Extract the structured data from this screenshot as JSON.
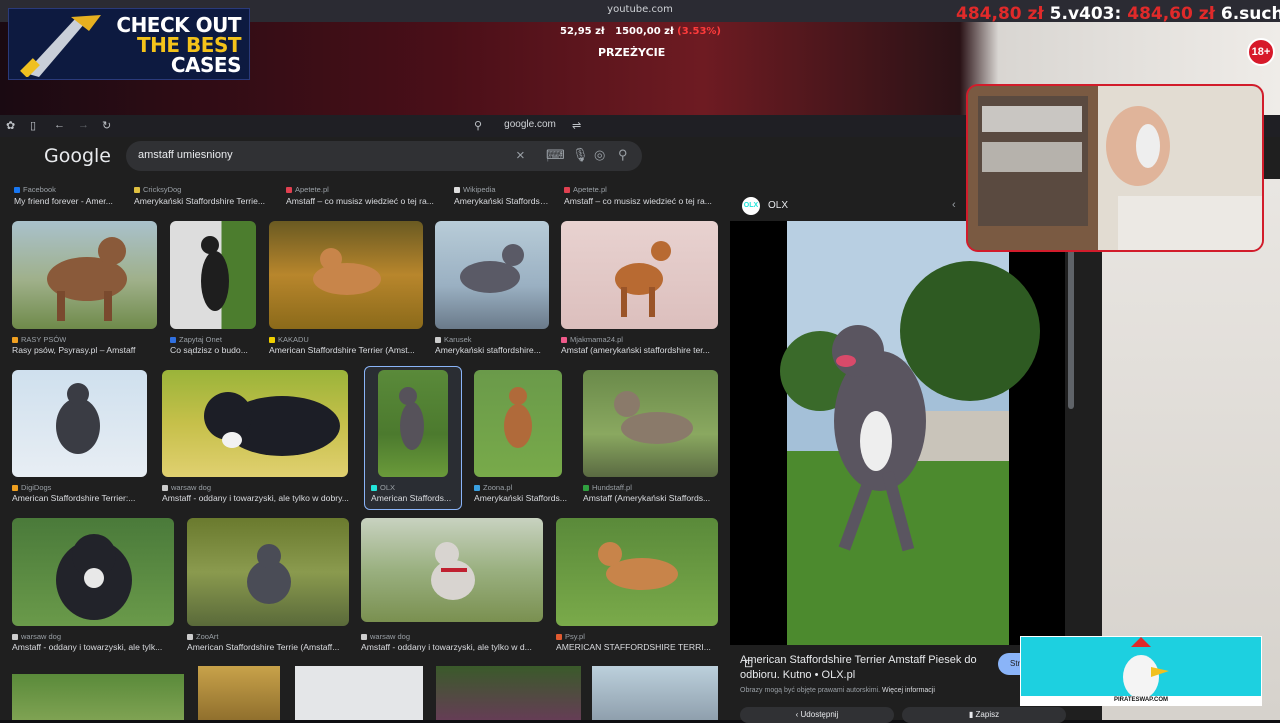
{
  "stream": {
    "top_url": "youtube.com",
    "promo": {
      "line1": "CHECK OUT",
      "line2": "THE BEST",
      "line3": "CASES"
    },
    "price_a": "52,95 zł",
    "price_b": "1500,00 zł",
    "price_pct": "(3.53%)",
    "label": "PRZEŻYCIE",
    "ticker_price1": "484,80 zł",
    "ticker_mid": "5.v403:",
    "ticker_price2": "484,60 zł",
    "ticker_user": "6.suchybil",
    "age_badge": "18+",
    "ad_label": "PIRATESWAP.COM"
  },
  "browser": {
    "url": "google.com"
  },
  "google": {
    "logo": "Google",
    "query": "amstaff umiesniony"
  },
  "results": {
    "row0": [
      {
        "source": "Facebook",
        "title": "My friend forever - Amer...",
        "color": "#1877f2"
      },
      {
        "source": "CricksyDog",
        "title": "Amerykański Staffordshire Terrie...",
        "color": "#e0c040"
      },
      {
        "source": "Apetete.pl",
        "title": "Amstaff – co musisz wiedzieć o tej ra...",
        "color": "#e04050"
      },
      {
        "source": "Wikipedia",
        "title": "Amerykański Staffordshire...",
        "color": "#dddddd"
      },
      {
        "source": "Apetete.pl",
        "title": "Amstaff – co musisz wiedzieć o tej ra...",
        "color": "#e04050"
      }
    ],
    "row1": [
      {
        "source": "RASY PSÓW",
        "title": "Rasy psów, Psyrasy.pl – Amstaff",
        "color": "#f0a020"
      },
      {
        "source": "Zapytaj Onet",
        "title": "Co sądzisz o budo...",
        "color": "#3070e0"
      },
      {
        "source": "KAKADU",
        "title": "American Staffordshire Terrier (Amst...",
        "color": "#f0d000"
      },
      {
        "source": "Karusek",
        "title": "Amerykański staffordshire...",
        "color": "#cccccc"
      },
      {
        "source": "Mjakmama24.pl",
        "title": "Amstaf (amerykański staffordshire ter...",
        "color": "#f05a8a"
      }
    ],
    "row2": [
      {
        "source": "DigiDogs",
        "title": "American Staffordshire Terrier:...",
        "color": "#f0a020"
      },
      {
        "source": "warsaw dog",
        "title": "Amstaff - oddany i towarzyski, ale tylko w dobry...",
        "color": "#cccccc"
      },
      {
        "source": "OLX",
        "title": "American Staffords...",
        "color": "#23e5db"
      },
      {
        "source": "Zoona.pl",
        "title": "Amerykański Staffords...",
        "color": "#3aa0e0"
      },
      {
        "source": "Hundstaff.pl",
        "title": "Amstaff (Amerykański Staffords...",
        "color": "#30a040"
      }
    ],
    "row3": [
      {
        "source": "warsaw dog",
        "title": "Amstaff - oddany i towarzyski, ale tylk...",
        "color": "#cccccc"
      },
      {
        "source": "ZooArt",
        "title": "American Staffordshire Terrie (Amstaff...",
        "color": "#cccccc"
      },
      {
        "source": "warsaw dog",
        "title": "Amstaff - oddany i towarzyski, ale tylko w d...",
        "color": "#cccccc"
      },
      {
        "source": "Psy.pl",
        "title": "AMERICAN STAFFORDSHIRE TERRI...",
        "color": "#e05a30"
      }
    ]
  },
  "preview": {
    "site": "OLX",
    "avatar_text": "OLX",
    "title": "American Staffordshire Terrier Amstaff Piesek do odbioru. Kutno • OLX.pl",
    "note": "Obrazy mogą być objęte prawami autorskimi.",
    "note_link": "Więcej informacji",
    "visit_label": "Str",
    "share_label": "Udostępnij",
    "save_label": "Zapisz"
  },
  "colors": {
    "accent": "#8ab4f8",
    "background": "#1f1f1f",
    "stream_red": "#d21c2b"
  }
}
